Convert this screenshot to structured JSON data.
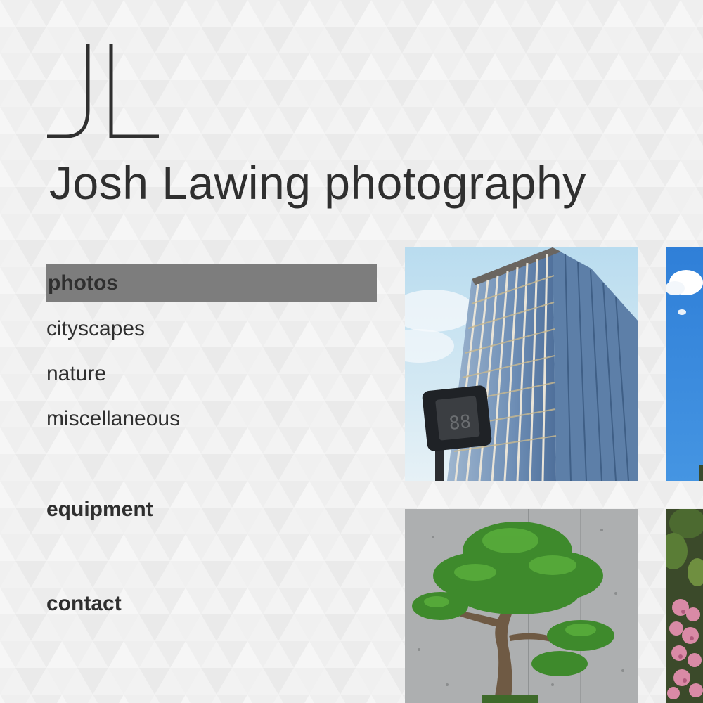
{
  "site": {
    "logo_monogram": "JL",
    "title": "Josh Lawing photography"
  },
  "nav": {
    "photos": "photos",
    "cityscapes": "cityscapes",
    "nature": "nature",
    "miscellaneous": "miscellaneous",
    "equipment": "equipment",
    "contact": "contact",
    "active_item": "photos",
    "active_color": "#7d7d7d"
  },
  "gallery": {
    "thumbnails": [
      {
        "subject": "office tower with crosswalk signal"
      },
      {
        "subject": "blue sky with clouds"
      },
      {
        "subject": "bonsai tree against concrete wall"
      },
      {
        "subject": "pink flowers with green leaves"
      }
    ]
  },
  "colors": {
    "text": "#2f2f2f",
    "background": "#f6f6f6",
    "pattern_shade": "#e9e9e9"
  }
}
